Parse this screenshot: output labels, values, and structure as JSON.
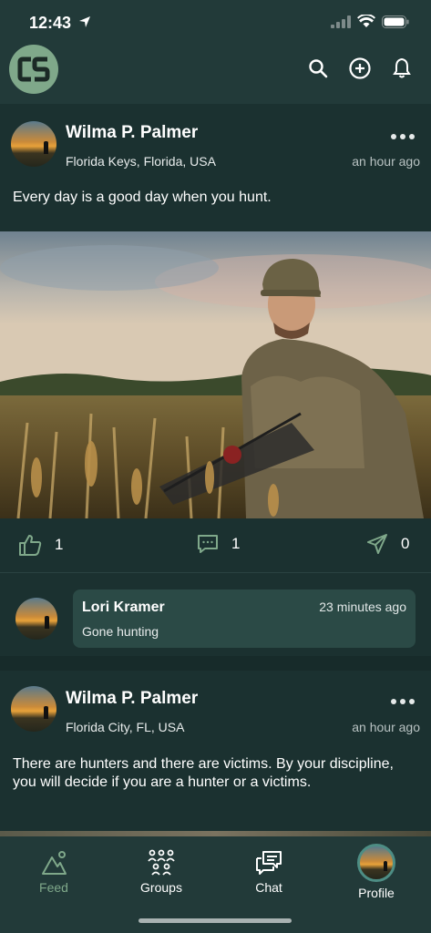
{
  "status_bar": {
    "time": "12:43"
  },
  "header": {
    "logo_text": "CS"
  },
  "posts": [
    {
      "author": "Wilma P. Palmer",
      "location": "Florida Keys, Florida, USA",
      "time": "an hour ago",
      "text": "Every day is a good day when you hunt.",
      "likes": "1",
      "comments": "1",
      "shares": "0",
      "comment": {
        "author": "Lori Kramer",
        "time": "23 minutes ago",
        "text": "Gone hunting"
      }
    },
    {
      "author": "Wilma P. Palmer",
      "location": "Florida City, FL, USA",
      "time": "an hour ago",
      "text": "There are hunters and there are victims. By your discipline, you will decide if you are a hunter or a victims."
    }
  ],
  "nav": [
    {
      "label": "Feed",
      "icon": "feed-icon",
      "active": true
    },
    {
      "label": "Groups",
      "icon": "groups-icon"
    },
    {
      "label": "Chat",
      "icon": "chat-icon"
    },
    {
      "label": "Profile",
      "icon": "profile-avatar"
    }
  ],
  "colors": {
    "background": "#1b3130",
    "header": "#223a39",
    "accent": "#7fa88a",
    "comment_bubble": "#2b4a46"
  }
}
